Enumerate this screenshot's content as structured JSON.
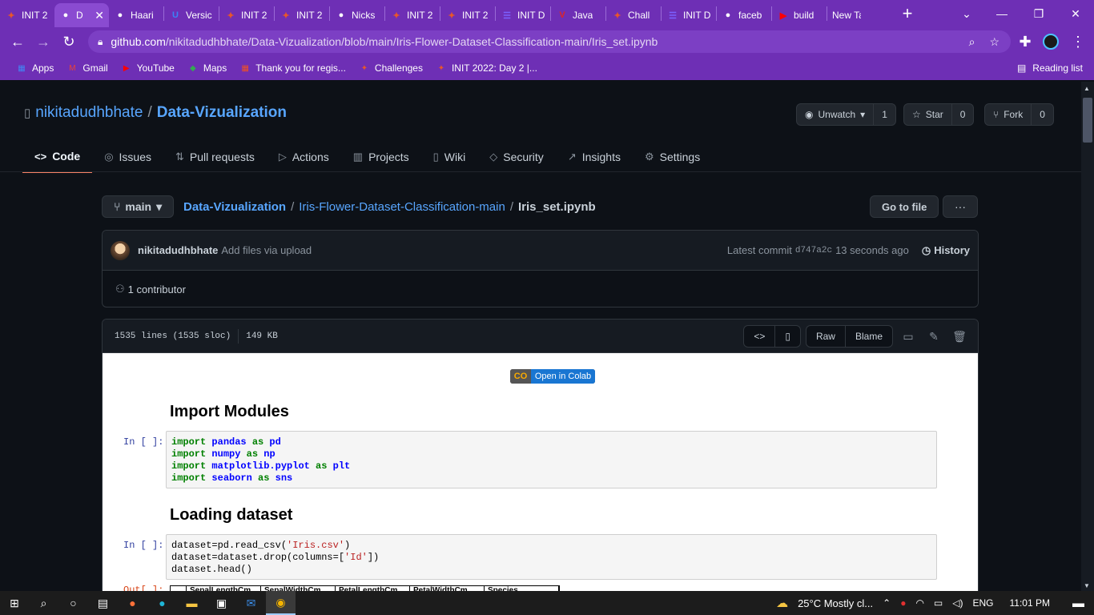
{
  "browser": {
    "tabs": [
      {
        "title": "INIT 2",
        "fav": "✦",
        "color": "#e8562a"
      },
      {
        "title": "D",
        "fav": "●",
        "color": "#ffffff",
        "active": true
      },
      {
        "title": "Haari",
        "fav": "●",
        "color": "#ffffff"
      },
      {
        "title": "Versic",
        "fav": "U",
        "color": "#3b82f6"
      },
      {
        "title": "INIT 2",
        "fav": "✦",
        "color": "#e8562a"
      },
      {
        "title": "INIT 2",
        "fav": "✦",
        "color": "#e8562a"
      },
      {
        "title": "Nicks",
        "fav": "●",
        "color": "#ffffff"
      },
      {
        "title": "INIT 2",
        "fav": "✦",
        "color": "#e8562a"
      },
      {
        "title": "INIT 2",
        "fav": "✦",
        "color": "#e8562a"
      },
      {
        "title": "INIT D",
        "fav": "☰",
        "color": "#7b61ff"
      },
      {
        "title": "Java",
        "fav": "V",
        "color": "#e02424"
      },
      {
        "title": "Chall",
        "fav": "✦",
        "color": "#e8562a"
      },
      {
        "title": "INIT D",
        "fav": "☰",
        "color": "#7b61ff"
      },
      {
        "title": "faceb",
        "fav": "●",
        "color": "#ffffff"
      },
      {
        "title": "build",
        "fav": "▶",
        "color": "#ff0000"
      },
      {
        "title": "New Tab",
        "fav": "",
        "color": "#ffffff"
      }
    ],
    "url_host": "github.com",
    "url_path": "/nikitadudhbhate/Data-Vizualization/blob/main/Iris-Flower-Dataset-Classification-main/Iris_set.ipynb",
    "bookmarks": [
      {
        "label": "Apps",
        "icon": "▦",
        "color": "#4285f4"
      },
      {
        "label": "Gmail",
        "icon": "M",
        "color": "#ea4335"
      },
      {
        "label": "YouTube",
        "icon": "▶",
        "color": "#ff0000"
      },
      {
        "label": "Maps",
        "icon": "◆",
        "color": "#34a853"
      },
      {
        "label": "Thank you for regis...",
        "icon": "▦",
        "color": "#f25022"
      },
      {
        "label": "Challenges",
        "icon": "✦",
        "color": "#e8562a"
      },
      {
        "label": "INIT 2022: Day 2 |...",
        "icon": "✦",
        "color": "#e8562a"
      }
    ],
    "reading_list": "Reading list"
  },
  "repo": {
    "owner": "nikitadudhbhate",
    "name": "Data-Vizualization",
    "unwatch": "Unwatch",
    "unwatch_count": "1",
    "star": "Star",
    "star_count": "0",
    "fork": "Fork",
    "fork_count": "0",
    "nav": [
      "Code",
      "Issues",
      "Pull requests",
      "Actions",
      "Projects",
      "Wiki",
      "Security",
      "Insights",
      "Settings"
    ],
    "nav_icons": [
      "<>",
      "◎",
      "⇅",
      "▷",
      "▥",
      "▯",
      "◇",
      "↗",
      "⚙"
    ]
  },
  "file": {
    "branch": "main",
    "crumb_repo": "Data-Vizualization",
    "crumb_folder": "Iris-Flower-Dataset-Classification-main",
    "crumb_file": "Iris_set.ipynb",
    "go_to_file": "Go to file",
    "more": "···",
    "commit_author": "nikitadudhbhate",
    "commit_message": "Add files via upload",
    "latest_commit_label": "Latest commit",
    "commit_sha": "d747a2c",
    "commit_time": "13 seconds ago",
    "history": "History",
    "contributors": "1 contributor",
    "lines": "1535 lines (1535 sloc)",
    "size": "149 KB",
    "raw": "Raw",
    "blame": "Blame"
  },
  "notebook": {
    "colab_badge": "Open in Colab",
    "heading1": "Import Modules",
    "heading2": "Loading dataset",
    "prompt_in": "In [ ]:",
    "prompt_out": "Out[ ]:",
    "cell1": [
      [
        "import",
        " pandas ",
        "as",
        " pd"
      ],
      [
        "import",
        " numpy ",
        "as",
        " np"
      ],
      [
        "import",
        " matplotlib.pyplot ",
        "as",
        " plt"
      ],
      [
        "import",
        " seaborn ",
        "as",
        " sns"
      ]
    ],
    "cell2": [
      "dataset=pd.read_csv('Iris.csv')",
      "dataset=dataset.drop(columns=['Id'])",
      "dataset.head()"
    ],
    "df_columns": [
      "",
      "SepalLengthCm",
      "SepalWidthCm",
      "PetalLengthCm",
      "PetalWidthCm",
      "Species"
    ]
  },
  "taskbar": {
    "weather": "25°C  Mostly cl...",
    "lang": "ENG",
    "time": "11:01 PM"
  }
}
